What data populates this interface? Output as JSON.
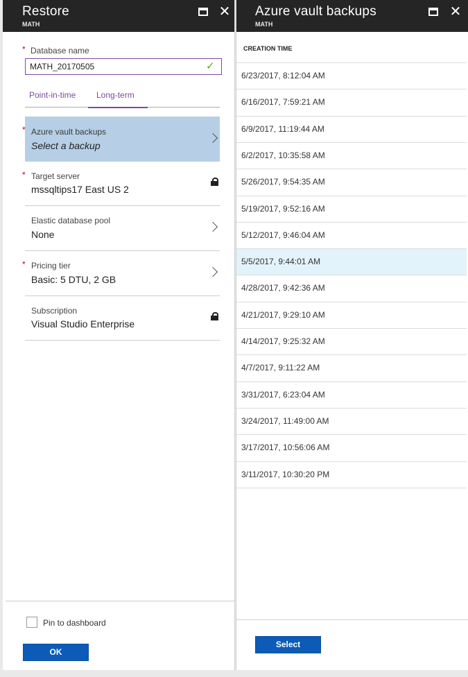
{
  "restore": {
    "title": "Restore",
    "subtitle": "MATH",
    "database_name_label": "Database name",
    "database_name_value": "MATH_20170505",
    "tabs": [
      {
        "label": "Point-in-time",
        "active": false
      },
      {
        "label": "Long-term",
        "active": true
      }
    ],
    "rows": [
      {
        "label": "Azure vault backups",
        "value": "Select a backup",
        "required": true,
        "icon": "chevron-right-icon"
      },
      {
        "label": "Target server",
        "value": "mssqltips17 East US 2",
        "required": true,
        "icon": "lock-icon"
      },
      {
        "label": "Elastic database pool",
        "value": "None",
        "required": false,
        "icon": "chevron-right-icon"
      },
      {
        "label": "Pricing tier",
        "value": "Basic: 5 DTU, 2 GB",
        "required": true,
        "icon": "chevron-right-icon"
      },
      {
        "label": "Subscription",
        "value": "Visual Studio Enterprise",
        "required": false,
        "icon": "lock-icon"
      }
    ],
    "pin_label": "Pin to dashboard",
    "ok_label": "OK"
  },
  "vault": {
    "title": "Azure vault backups",
    "subtitle": "MATH",
    "column_header": "CREATION TIME",
    "backups": [
      "6/23/2017, 8:12:04 AM",
      "6/16/2017, 7:59:21 AM",
      "6/9/2017, 11:19:44 AM",
      "6/2/2017, 10:35:58 AM",
      "5/26/2017, 9:54:35 AM",
      "5/19/2017, 9:52:16 AM",
      "5/12/2017, 9:46:04 AM",
      "5/5/2017, 9:44:01 AM",
      "4/28/2017, 9:42:36 AM",
      "4/21/2017, 9:29:10 AM",
      "4/14/2017, 9:25:32 AM",
      "4/7/2017, 9:11:22 AM",
      "3/31/2017, 6:23:04 AM",
      "3/24/2017, 11:49:00 AM",
      "3/17/2017, 10:56:06 AM",
      "3/11/2017, 10:30:20 PM"
    ],
    "selected_backup": "5/5/2017, 9:44:01 AM",
    "select_label": "Select"
  },
  "colors": {
    "header_bg": "#252525",
    "accent_purple": "#7a4aa0",
    "selected_row_bg": "#b6cfe6",
    "list_hover_bg": "#e3f3fb",
    "button_blue": "#0b5bb7",
    "required_red": "#b4002b",
    "valid_green": "#5ea619"
  }
}
